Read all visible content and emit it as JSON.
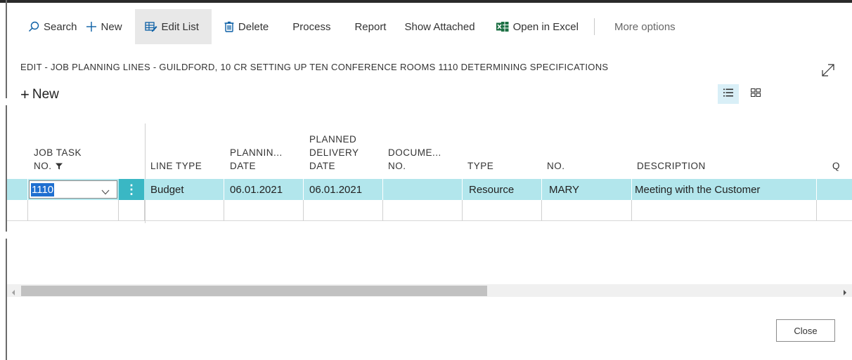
{
  "toolbar": {
    "search": "Search",
    "new": "New",
    "edit_list": "Edit List",
    "delete": "Delete",
    "process": "Process",
    "report": "Report",
    "show_attached": "Show Attached",
    "open_in_excel": "Open in Excel",
    "more_options": "More options"
  },
  "page_title": "EDIT - JOB PLANNING LINES - GUILDFORD, 10 CR SETTING UP TEN CONFERENCE ROOMS 1110 DETERMINING SPECIFICATIONS",
  "new_button": "New",
  "columns": {
    "job_task_no": "JOB TASK",
    "job_task_no_2": "NO.",
    "line_type": "LINE TYPE",
    "planning_date_1": "PLANNIN...",
    "planning_date_2": "DATE",
    "planned_delivery_1": "PLANNED",
    "planned_delivery_2": "DELIVERY",
    "planned_delivery_3": "DATE",
    "document_no_1": "DOCUME...",
    "document_no_2": "NO.",
    "type": "TYPE",
    "no": "NO.",
    "description": "DESCRIPTION",
    "quantity_cut": "Q"
  },
  "rows": [
    {
      "job_task_no": "1110",
      "line_type": "Budget",
      "planning_date": "06.01.2021",
      "planned_delivery_date": "06.01.2021",
      "document_no": "",
      "type": "Resource",
      "no": "MARY",
      "description": "Meeting with the Customer"
    }
  ],
  "close_button": "Close",
  "colors": {
    "selected_row": "#b2e6ec",
    "row_action": "#3ab7c4",
    "selection_text_bg": "#1f6fd0",
    "excel_green": "#1d7044"
  }
}
